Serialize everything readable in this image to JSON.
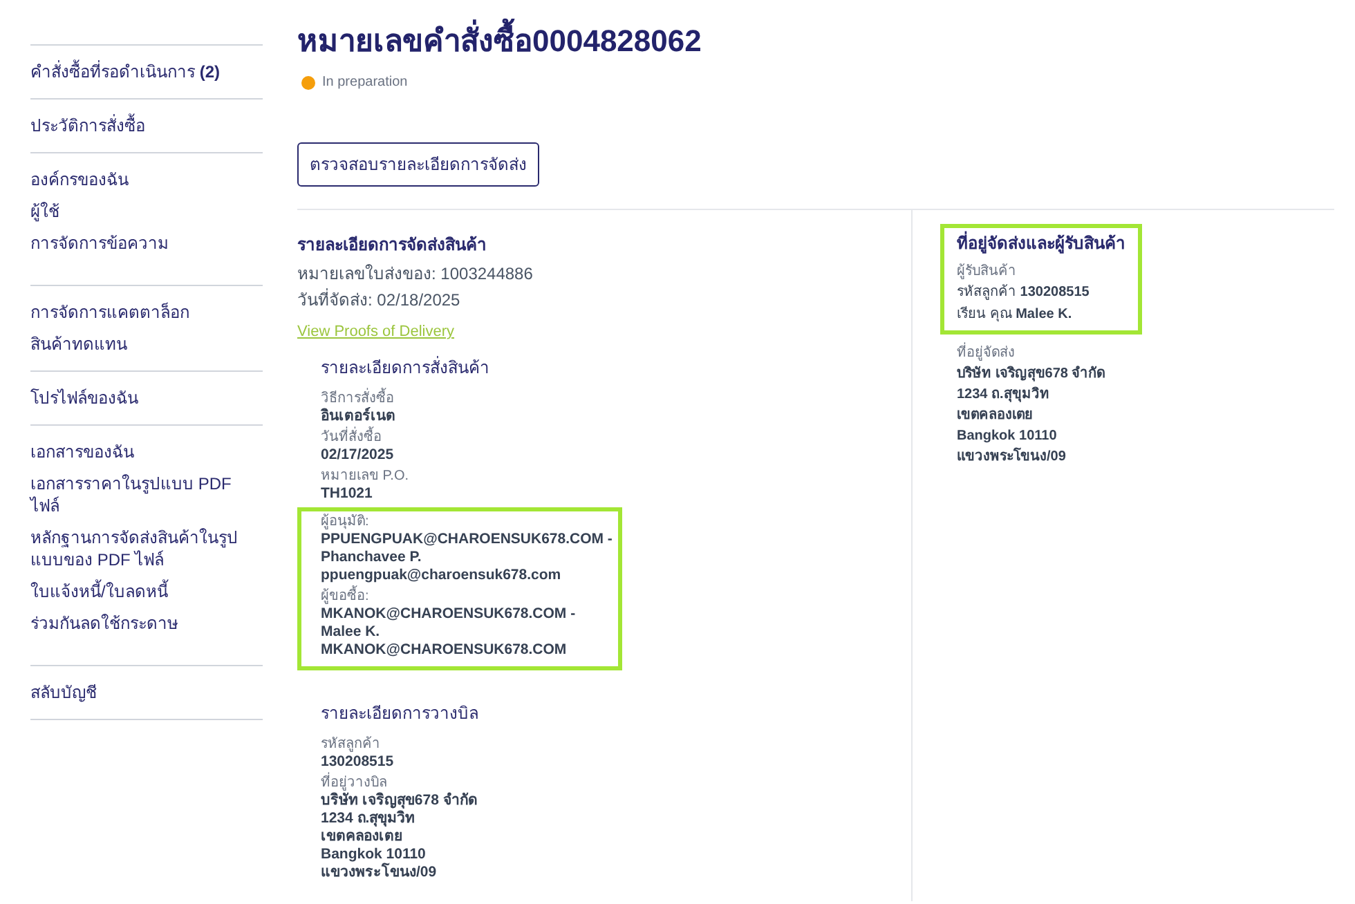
{
  "sidebar": {
    "groups": [
      [
        {
          "label": "คำสั่งซื้อที่รอดำเนินการ **(2)**"
        }
      ],
      [
        {
          "label": "ประวัติการสั่งซื้อ"
        }
      ],
      [
        {
          "label": "องค์กรของฉัน"
        },
        {
          "label": "ผู้ใช้"
        },
        {
          "label": "การจัดการข้อความ"
        }
      ],
      [
        {
          "label": "การจัดการแคตตาล็อก"
        },
        {
          "label": "สินค้าทดแทน"
        }
      ],
      [
        {
          "label": "โปรไฟล์ของฉัน"
        }
      ],
      [
        {
          "label": "เอกสารของฉัน"
        },
        {
          "label": "เอกสารราคาในรูปแบบ PDF ไฟล์"
        },
        {
          "label": "หลักฐานการจัดส่งสินค้าในรูปแบบของ PDF ไฟล์"
        },
        {
          "label": "ใบแจ้งหนี้/ใบลดหนี้"
        },
        {
          "label": "ร่วมกันลดใช้กระดาษ"
        }
      ],
      [
        {
          "label": "สลับบัญชี"
        }
      ]
    ]
  },
  "title": "หมายเลขคำสั่งซื้อ0004828062",
  "status": {
    "label": "In preparation",
    "color": "#f59e0b"
  },
  "action_button": "ตรวจสอบรายละเอียดการจัดส่ง",
  "shipment": {
    "heading": "รายละเอียดการจัดส่งสินค้า",
    "lines": [
      "หมายเลขใบส่งของ: 1003244886",
      "วันที่จัดส่ง: 02/18/2025"
    ],
    "link": "View Proofs of Delivery"
  },
  "order_details": {
    "heading": "รายละเอียดการสั่งสินค้า",
    "sections": [
      {
        "fields": [
          {
            "label": "วิธีการสั่งซื้อ",
            "lines": [
              "อินเตอร์เนต"
            ]
          },
          {
            "label": "วันที่สั่งซื้อ",
            "lines": [
              "02/17/2025"
            ]
          },
          {
            "label": "หมายเลข P.O.",
            "lines": [
              "TH1021"
            ]
          }
        ]
      },
      {
        "highlighted": true,
        "fields": [
          {
            "label": "ผู้อนุมัติ:",
            "lines": [
              "PPUENGPUAK@CHAROENSUK678.COM - Phanchavee P.",
              "ppuengpuak@charoensuk678.com"
            ]
          },
          {
            "label": "ผู้ขอซื้อ:",
            "lines": [
              "MKANOK@CHAROENSUK678.COM - Malee K.",
              "MKANOK@CHAROENSUK678.COM"
            ]
          }
        ]
      }
    ]
  },
  "billing": {
    "heading": "รายละเอียดการวางบิล",
    "sections": [
      {
        "fields": [
          {
            "label": "รหัสลูกค้า",
            "lines": [
              "130208515"
            ]
          },
          {
            "label": "ที่อยู่วางบิล",
            "lines": [
              "บริษัท เจริญสุข678 จำกัด",
              "1234 ถ.สุขุมวิท",
              "เขตคลองเตย",
              "Bangkok 10110",
              "แขวงพระโขนง/09"
            ]
          }
        ]
      }
    ]
  },
  "delivery": {
    "heading": "ที่อยู่จัดส่งและผู้รับสินค้า",
    "highlighted": true,
    "recipient_label": "ผู้รับสินค้า",
    "recipient_lines": [
      "รหัสลูกค้า **130208515**",
      "เรียน คุณ **Malee K.**"
    ],
    "address_label": "ที่อยู่จัดส่ง",
    "address_lines": [
      "บริษัท เจริญสุข678 จำกัด",
      "1234 ถ.สุขุมวิท",
      "เขตคลองเตย",
      "Bangkok 10110",
      "แขวงพระโขนง/09"
    ]
  }
}
